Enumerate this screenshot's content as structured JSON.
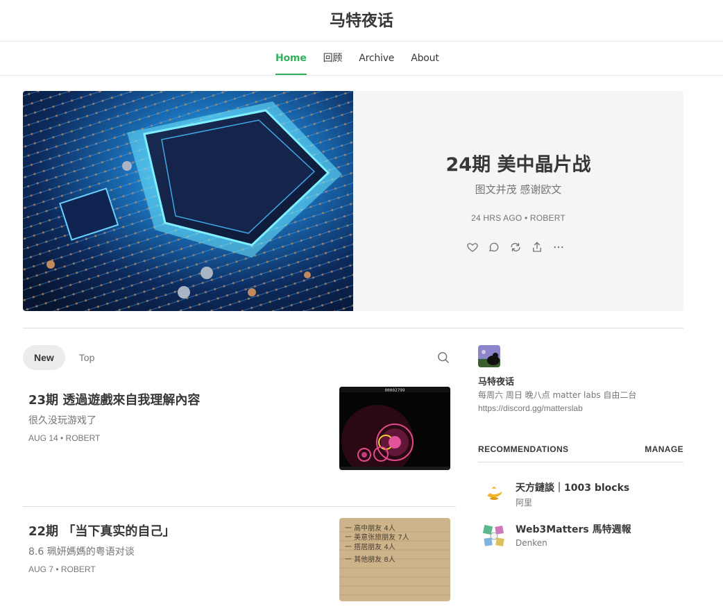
{
  "site": {
    "title": "马特夜话"
  },
  "nav": {
    "items": [
      {
        "label": "Home"
      },
      {
        "label": "回顾"
      },
      {
        "label": "Archive"
      },
      {
        "label": "About"
      }
    ]
  },
  "hero": {
    "title": "24期 美中晶片战",
    "subtitle": "图文并茂 感谢欧文",
    "meta": "24 HRS AGO • ROBERT",
    "actions": [
      "heart-icon",
      "comment-icon",
      "restack-icon",
      "share-icon",
      "more-icon"
    ]
  },
  "tabs": [
    {
      "label": "New"
    },
    {
      "label": "Top"
    }
  ],
  "posts": [
    {
      "title": "23期 透過遊戲來自我理解內容",
      "subtitle": "很久没玩游戏了",
      "meta": "AUG 14 • ROBERT",
      "thumb_score": "00002799"
    },
    {
      "title": "22期 「当下真实的自己」",
      "subtitle": "8.6 珮妍媽媽的粤语对谈",
      "meta": "AUG 7 • ROBERT",
      "note_lines": [
        "一 高中朋友 4人",
        "一 美意张旅朋友 7人",
        "一 搭居朋友 4人",
        "一 其他朋友 8人"
      ]
    }
  ],
  "sidebar": {
    "pub_name": "马特夜话",
    "pub_desc": "每周六 周日 晚八点 matter labs 自由二台",
    "pub_link": "https://discord.gg/matterslab",
    "rec_label": "RECOMMENDATIONS",
    "rec_manage": "MANAGE",
    "recs": [
      {
        "name": "天方鏈談｜1003 blocks",
        "author": "阿里"
      },
      {
        "name": "Web3Matters 馬特週報",
        "author": "Denken"
      }
    ]
  },
  "colors": {
    "accent": "#2fb25b",
    "text": "#363737",
    "muted": "#757575",
    "hero_bg": "#f5f5f5"
  }
}
